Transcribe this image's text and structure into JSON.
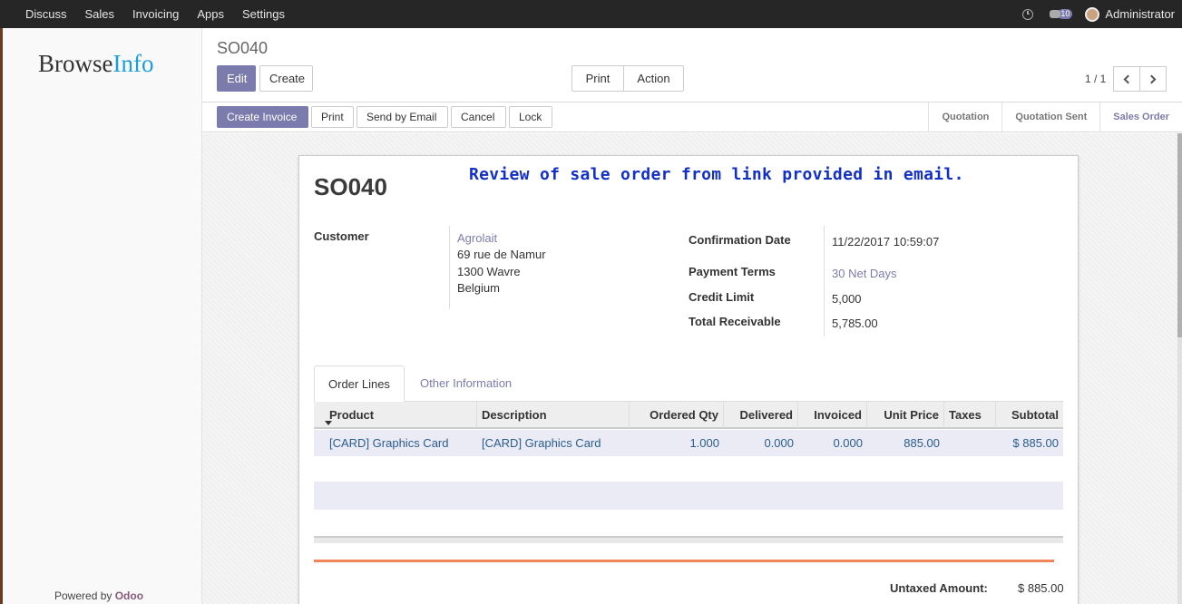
{
  "topbar": {
    "menu": [
      "Discuss",
      "Sales",
      "Invoicing",
      "Apps",
      "Settings"
    ],
    "chat_count": "10",
    "user_name": "Administrator"
  },
  "sidebar": {
    "logo_part1": "Browse",
    "logo_part2": "Info",
    "powered_by": "Powered by",
    "powered_brand": "Odoo"
  },
  "control_panel": {
    "breadcrumb": "SO040",
    "edit_label": "Edit",
    "create_label": "Create",
    "print_label": "Print",
    "action_label": "Action",
    "pager": "1 / 1"
  },
  "statusbar": {
    "buttons": [
      "Create Invoice",
      "Print",
      "Send by Email",
      "Cancel",
      "Lock"
    ],
    "stages": [
      "Quotation",
      "Quotation Sent",
      "Sales Order"
    ],
    "active_stage": "Sales Order"
  },
  "form": {
    "title": "SO040",
    "annotation": "Review of sale order from link provided in email.",
    "customer_label": "Customer",
    "customer_name": "Agrolait",
    "address_line1": "69 rue de Namur",
    "address_line2": "1300 Wavre",
    "address_line3": "Belgium",
    "confirmation_date_label": "Confirmation Date",
    "confirmation_date": "11/22/2017 10:59:07",
    "payment_terms_label": "Payment Terms",
    "payment_terms": "30 Net Days",
    "credit_limit_label": "Credit Limit",
    "credit_limit": "5,000",
    "total_receivable_label": "Total Receivable",
    "total_receivable": "5,785.00"
  },
  "tabs": {
    "order_lines": "Order Lines",
    "other_information": "Other Information"
  },
  "order_table": {
    "headers": [
      "Product",
      "Description",
      "Ordered Qty",
      "Delivered",
      "Invoiced",
      "Unit Price",
      "Taxes",
      "Subtotal"
    ],
    "rows": [
      {
        "product": "[CARD] Graphics Card",
        "description": "[CARD] Graphics Card",
        "ordered_qty": "1.000",
        "delivered": "0.000",
        "invoiced": "0.000",
        "unit_price": "885.00",
        "taxes": "",
        "subtotal": "$ 885.00"
      }
    ]
  },
  "totals": {
    "untaxed_label": "Untaxed Amount:",
    "untaxed_value": "$ 885.00"
  },
  "colors": {
    "brand": "#7c7bad",
    "topbar": "#262626",
    "annotation": "#1230c8",
    "logo_accent": "#1a9fd8",
    "orange_rule": "#f0875a"
  }
}
